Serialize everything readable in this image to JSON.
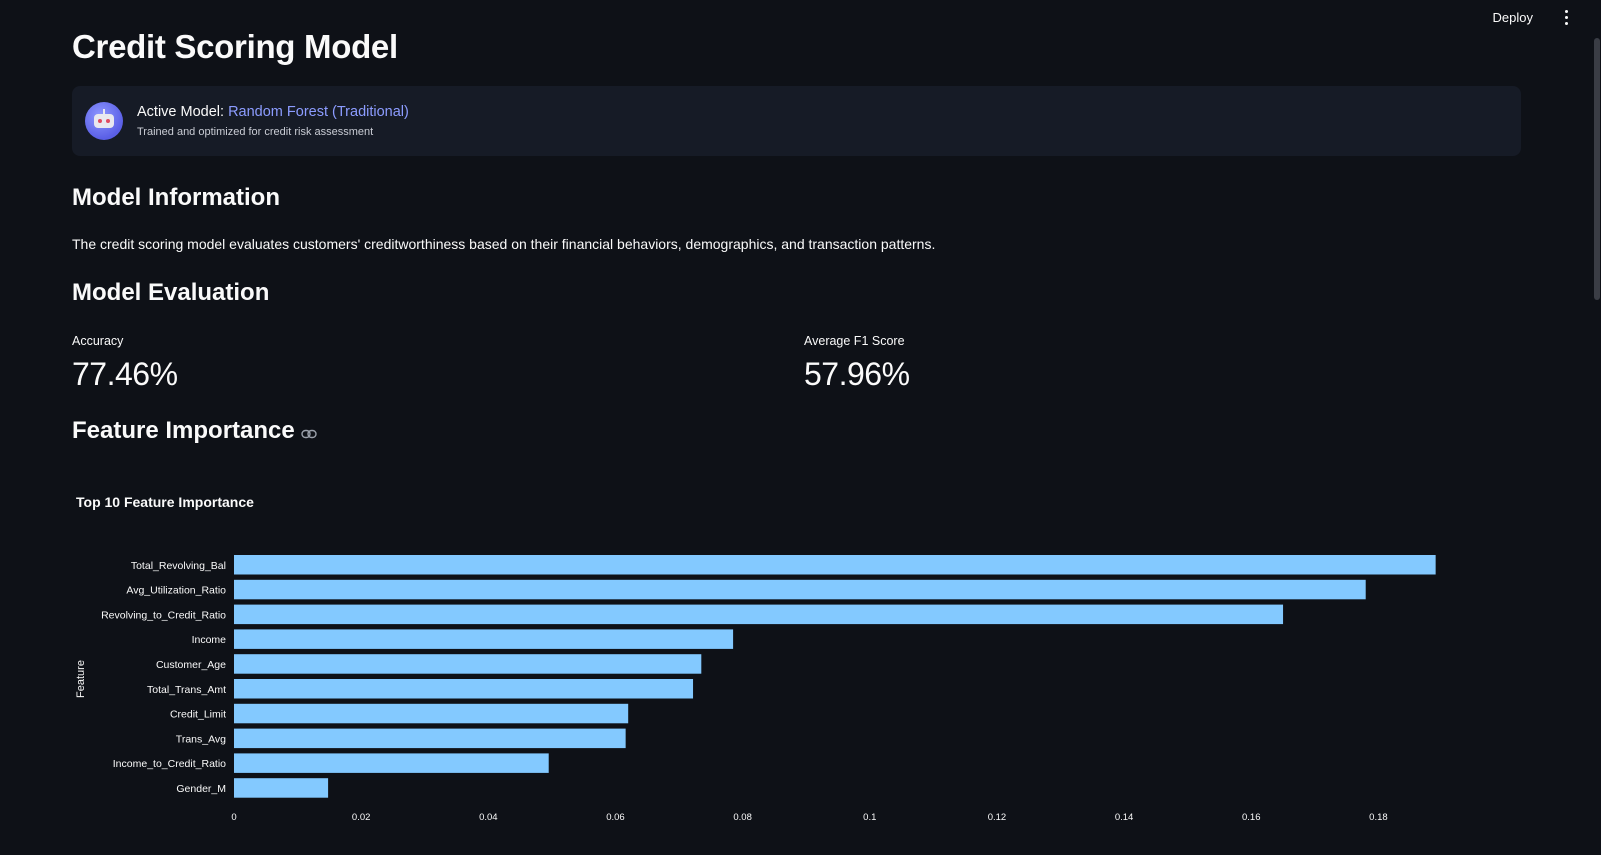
{
  "topbar": {
    "deploy_label": "Deploy"
  },
  "page": {
    "title": "Credit Scoring Model"
  },
  "model_card": {
    "prefix": "Active Model:",
    "model_name": "Random Forest (Traditional)",
    "subtitle": "Trained and optimized for credit risk assessment",
    "accent_color": "#8c9cff"
  },
  "model_info": {
    "heading": "Model Information",
    "description": "The credit scoring model evaluates customers' creditworthiness based on their financial behaviors, demographics, and transaction patterns."
  },
  "evaluation": {
    "heading": "Model Evaluation",
    "metrics": [
      {
        "label": "Accuracy",
        "value": "77.46%"
      },
      {
        "label": "Average F1 Score",
        "value": "57.96%"
      }
    ]
  },
  "feature_importance": {
    "heading": "Feature Importance"
  },
  "chart_data": {
    "type": "bar",
    "orientation": "horizontal",
    "title": "Top 10 Feature Importance",
    "xlabel": "",
    "ylabel": "Feature",
    "bar_color": "#83c9ff",
    "categories": [
      "Total_Revolving_Bal",
      "Avg_Utilization_Ratio",
      "Revolving_to_Credit_Ratio",
      "Income",
      "Customer_Age",
      "Total_Trans_Amt",
      "Credit_Limit",
      "Trans_Avg",
      "Income_to_Credit_Ratio",
      "Gender_M"
    ],
    "values": [
      0.189,
      0.178,
      0.165,
      0.0785,
      0.0735,
      0.0722,
      0.062,
      0.0616,
      0.0495,
      0.0148
    ],
    "xlim": [
      0,
      0.19
    ],
    "xticks": [
      0,
      0.02,
      0.04,
      0.06,
      0.08,
      0.1,
      0.12,
      0.14,
      0.16,
      0.18
    ],
    "xtick_labels": [
      "0",
      "0.02",
      "0.04",
      "0.06",
      "0.08",
      "0.1",
      "0.12",
      "0.14",
      "0.16",
      "0.18"
    ],
    "grid": false
  }
}
